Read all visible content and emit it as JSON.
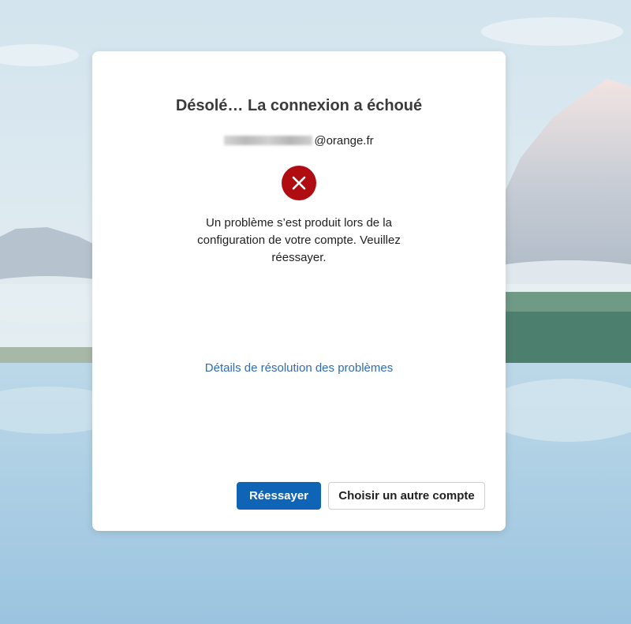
{
  "dialog": {
    "title": "Désolé… La connexion a échoué",
    "email_domain": "@orange.fr",
    "error_icon": "error-x-icon",
    "message": "Un problème s’est produit lors de la configuration de votre compte. Veuillez réessayer.",
    "details_link": "Détails de résolution des problèmes"
  },
  "buttons": {
    "retry": "Réessayer",
    "choose_account": "Choisir un autre compte"
  },
  "colors": {
    "primary": "#0f64b6",
    "error": "#b00d12",
    "link": "#2e6cb5"
  }
}
